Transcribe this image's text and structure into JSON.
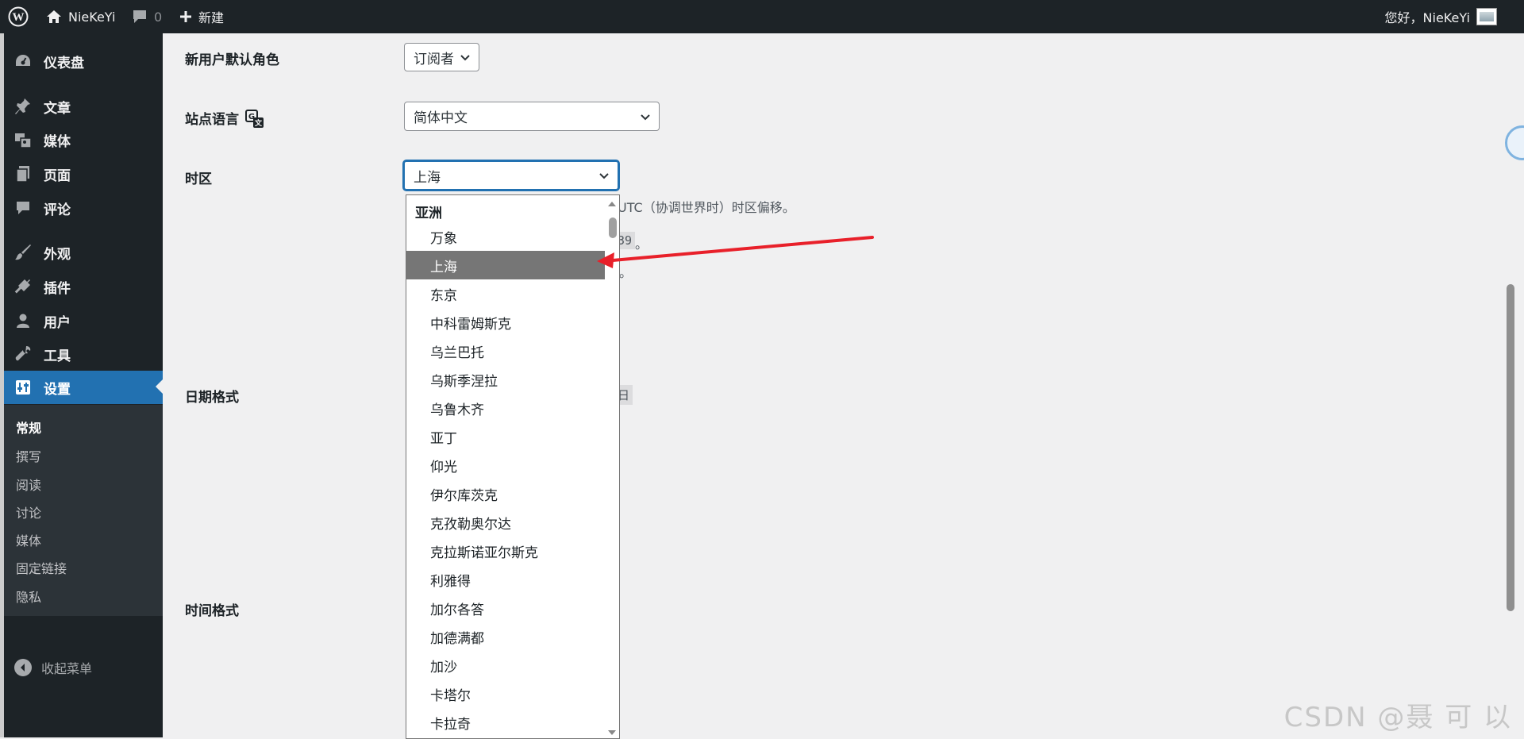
{
  "adminbar": {
    "site_name": "NieKeYi",
    "comment_count": "0",
    "new_label": "新建",
    "greeting": "您好，NieKeYi"
  },
  "sidebar": {
    "items": [
      {
        "label": "仪表盘",
        "icon": "dashboard-icon"
      },
      {
        "label": "文章",
        "icon": "pin-icon"
      },
      {
        "label": "媒体",
        "icon": "media-icon"
      },
      {
        "label": "页面",
        "icon": "page-icon"
      },
      {
        "label": "评论",
        "icon": "comment-icon"
      },
      {
        "label": "外观",
        "icon": "brush-icon"
      },
      {
        "label": "插件",
        "icon": "plugin-icon"
      },
      {
        "label": "用户",
        "icon": "user-icon"
      },
      {
        "label": "工具",
        "icon": "wrench-icon"
      },
      {
        "label": "设置",
        "icon": "settings-icon"
      }
    ],
    "submenu": [
      "常规",
      "撰写",
      "阅读",
      "讨论",
      "媒体",
      "固定链接",
      "隐私"
    ],
    "collapse_label": "收起菜单"
  },
  "settings": {
    "default_role_label": "新用户默认角色",
    "default_role_value": "订阅者",
    "site_language_label": "站点语言",
    "site_language_value": "简体中文",
    "timezone_label": "时区",
    "timezone_value": "上海",
    "timezone_desc_tail": "UTC（协调世界时）时区偏移。",
    "utc_time_tail": "39",
    "period_1": "。",
    "period_2": "。",
    "date_format_label": "日期格式",
    "date_sample_tail": "日",
    "time_format_label": "时间格式"
  },
  "dropdown": {
    "group_label": "亚洲",
    "options": [
      "万象",
      "上海",
      "东京",
      "中科雷姆斯克",
      "乌兰巴托",
      "乌斯季涅拉",
      "乌鲁木齐",
      "亚丁",
      "仰光",
      "伊尔库茨克",
      "克孜勒奥尔达",
      "克拉斯诺亚尔斯克",
      "利雅得",
      "加尔各答",
      "加德满都",
      "加沙",
      "卡塔尔",
      "卡拉奇"
    ],
    "selected_index": 1
  },
  "watermark": "CSDN @聂 可 以",
  "colors": {
    "adminbar_bg": "#1d2327",
    "active_menu": "#2271b1",
    "annotation_arrow": "#e8202a"
  }
}
